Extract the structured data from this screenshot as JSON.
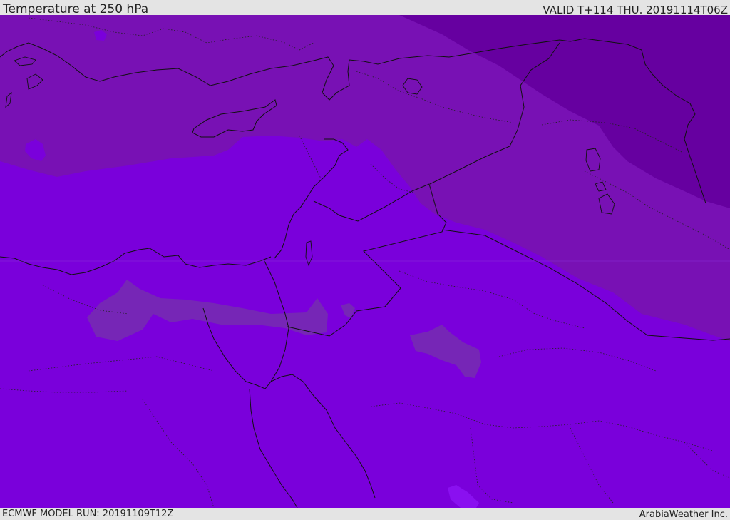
{
  "header": {
    "title": "Temperature at 250 hPa",
    "valid_time": "VALID T+114 THU. 20191114T06Z"
  },
  "footer": {
    "model_run": "ECMWF MODEL RUN: 20191109T12Z",
    "credit": "ArabiaWeather Inc."
  },
  "map": {
    "variable": "temperature",
    "level_hpa": 250,
    "colors": {
      "base_fill": "#7a00db",
      "mid_fill": "#7811b4",
      "cold_fill": "#6600a0",
      "warm_patch": "#7626b6",
      "border_line": "#111111",
      "internal_border": "#222222"
    }
  }
}
